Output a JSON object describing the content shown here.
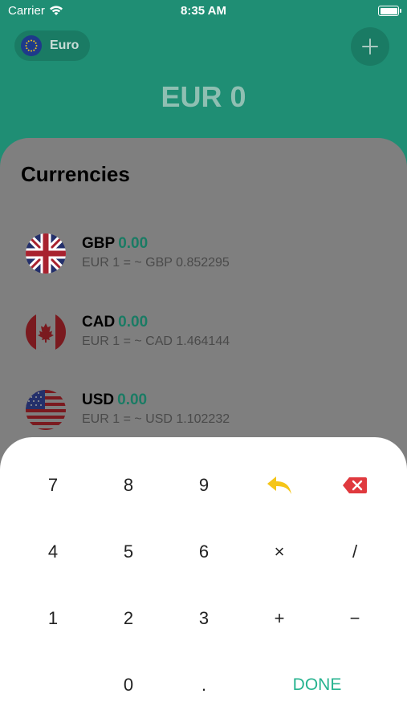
{
  "status_bar": {
    "carrier": "Carrier",
    "time": "8:35 AM"
  },
  "header": {
    "base_currency_label": "Euro",
    "amount": "EUR 0",
    "add_icon": "plus-icon"
  },
  "sheet": {
    "title": "Currencies"
  },
  "currencies": [
    {
      "code": "GBP",
      "value": "0.00",
      "rate": "EUR 1 = ~ GBP 0.852295",
      "flag": "uk-flag-icon"
    },
    {
      "code": "CAD",
      "value": "0.00",
      "rate": "EUR 1 = ~ CAD 1.464144",
      "flag": "canada-flag-icon"
    },
    {
      "code": "USD",
      "value": "0.00",
      "rate": "EUR 1 = ~ USD 1.102232",
      "flag": "us-flag-icon"
    }
  ],
  "keypad": {
    "keys": [
      "7",
      "8",
      "9",
      "4",
      "5",
      "6",
      "×",
      "/",
      "1",
      "2",
      "3",
      "+",
      "−",
      "0",
      ".",
      "DONE"
    ],
    "undo_icon": "undo-icon",
    "backspace_icon": "backspace-icon"
  },
  "colors": {
    "accent": "#1f8e74",
    "done": "#27b38f",
    "undo": "#f5c518",
    "backspace": "#e0393e"
  }
}
